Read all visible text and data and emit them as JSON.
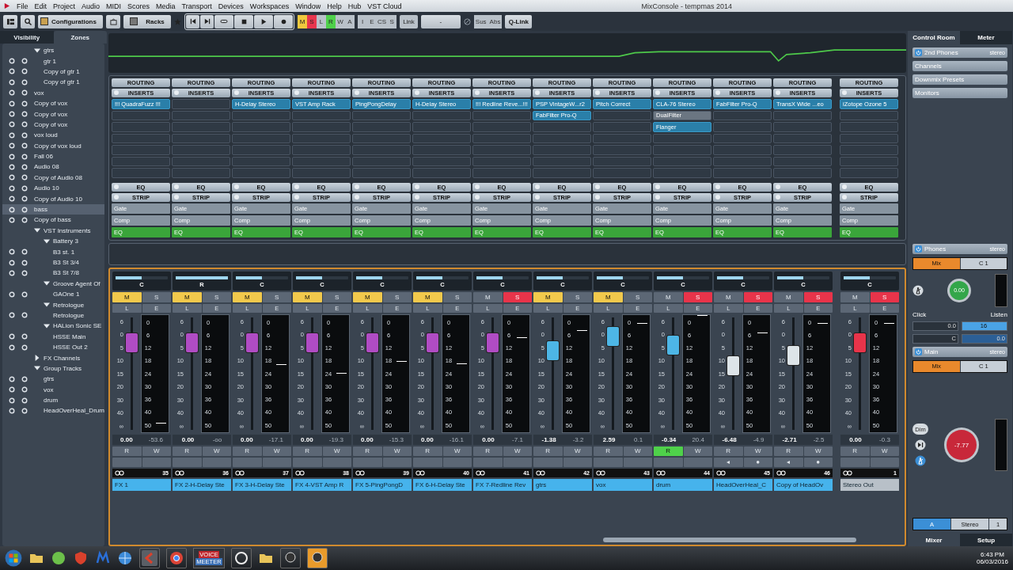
{
  "menu": [
    "File",
    "Edit",
    "Project",
    "Audio",
    "MIDI",
    "Scores",
    "Media",
    "Transport",
    "Devices",
    "Workspaces",
    "Window",
    "Help",
    "Hub",
    "VST Cloud"
  ],
  "window": {
    "title": "MixConsole - tempmas 2014"
  },
  "toolbar": {
    "configurations": "Configurations",
    "racks": "Racks",
    "modes": [
      {
        "label": "M",
        "on": true,
        "color": "#f0c93e"
      },
      {
        "label": "S",
        "on": true,
        "color": "#e8364e"
      },
      {
        "label": "L",
        "on": false
      },
      {
        "label": "R",
        "on": true,
        "color": "#4fd14a"
      },
      {
        "label": "W",
        "on": false
      },
      {
        "label": "A",
        "on": false
      }
    ],
    "modes2": [
      "I",
      "E",
      "CS",
      "S"
    ],
    "link_label": "Link",
    "link_value": "-",
    "sus": "Sus",
    "abs": "Abs",
    "qlink": "Q-Link"
  },
  "left_tabs": [
    {
      "label": "Visibility",
      "selected": false
    },
    {
      "label": "Zones",
      "selected": true
    }
  ],
  "tree": [
    {
      "label": "gtrs",
      "expanded": true,
      "selected": false,
      "children": [
        {
          "label": "gtr 1",
          "selected": false
        },
        {
          "label": "Copy of gtr 1",
          "selected": false
        },
        {
          "label": "Copy of gtr 1",
          "selected": false
        }
      ]
    },
    {
      "label": "vox",
      "selected": false
    },
    {
      "label": "Copy of vox",
      "selected": false
    },
    {
      "label": "Copy of vox",
      "selected": false
    },
    {
      "label": "Copy of vox",
      "selected": false
    },
    {
      "label": "vox loud",
      "selected": false
    },
    {
      "label": "Copy of vox loud",
      "selected": false
    },
    {
      "label": "Fall 06",
      "selected": false
    },
    {
      "label": "Audio 08",
      "selected": false
    },
    {
      "label": "Copy of Audio 08",
      "selected": false
    },
    {
      "label": "Audio 10",
      "selected": false
    },
    {
      "label": "Copy of Audio 10",
      "selected": false
    },
    {
      "label": "bass",
      "selected": true
    },
    {
      "label": "Copy of bass",
      "selected": false
    },
    {
      "label": "VST Instruments",
      "expanded": true,
      "selected": false,
      "children": [
        {
          "label": "Battery 3",
          "expanded": true,
          "selected": false,
          "children": [
            {
              "label": "B3 st. 1",
              "selected": false
            },
            {
              "label": "B3 St 3/4",
              "selected": false
            },
            {
              "label": "B3 St 7/8",
              "selected": false
            }
          ]
        },
        {
          "label": "Groove Agent Of",
          "expanded": true,
          "selected": false,
          "children": [
            {
              "label": "GAOne 1",
              "selected": false
            }
          ]
        },
        {
          "label": "Retrologue",
          "expanded": true,
          "selected": false,
          "children": [
            {
              "label": "Retrologue",
              "selected": false
            }
          ]
        },
        {
          "label": "HALion Sonic SE",
          "expanded": true,
          "selected": false,
          "children": [
            {
              "label": "HSSE Main",
              "selected": false
            },
            {
              "label": "HSSE Out 2",
              "selected": false
            }
          ]
        }
      ]
    },
    {
      "label": "FX Channels",
      "expanded": false,
      "selected": false
    },
    {
      "label": "Group Tracks",
      "expanded": true,
      "selected": false,
      "children": [
        {
          "label": "gtrs",
          "selected": false
        },
        {
          "label": "vox",
          "selected": false
        },
        {
          "label": "drum",
          "selected": false
        },
        {
          "label": "HeadOverHeal_Drum",
          "selected": false
        }
      ]
    }
  ],
  "channels": [
    {
      "name": "FX 1",
      "number": "35",
      "kind": "channel",
      "color": "#b04cc4",
      "pan": {
        "label": "C",
        "level": 0.5
      },
      "mute": {
        "label": "M",
        "on": true
      },
      "solo": {
        "label": "S",
        "on": false
      },
      "listen": "L",
      "edit": "E",
      "fader": {
        "level": 0.77
      },
      "meter": {
        "level": 0.07
      },
      "volume": "0.00",
      "peak": "-53.6",
      "read": {
        "label": "R",
        "on": false
      },
      "write": {
        "label": "W",
        "on": false
      },
      "routing": "ROUTING",
      "inserts_label": "INSERTS",
      "inserts": [
        {
          "name": "!!! QuadraFuzz !!!",
          "active": true
        }
      ],
      "eq": "EQ",
      "strip": "STRIP",
      "modules": [
        {
          "label": "Gate",
          "on": false
        },
        {
          "label": "Comp",
          "on": false
        },
        {
          "label": "EQ",
          "on": true
        }
      ],
      "fader_scale": [
        "6",
        "0",
        "5",
        "10",
        "15",
        "20",
        "30",
        "40",
        "∞"
      ],
      "meter_scale": [
        "0",
        "6",
        "12",
        "18",
        "24",
        "30",
        "36",
        "40",
        "50"
      ]
    },
    {
      "name": "FX 2-H-Delay Ste",
      "number": "36",
      "kind": "channel",
      "color": "#b04cc4",
      "pan": {
        "label": "R",
        "level": 1
      },
      "mute": {
        "label": "M",
        "on": true
      },
      "solo": {
        "label": "S",
        "on": false
      },
      "listen": "L",
      "edit": "E",
      "fader": {
        "level": 0.77
      },
      "volume": "0.00",
      "peak": "-oo",
      "read": {
        "label": "R",
        "on": false
      },
      "write": {
        "label": "W",
        "on": false
      },
      "routing": "ROUTING",
      "inserts_label": "INSERTS",
      "eq": "EQ",
      "strip": "STRIP",
      "modules": [
        {
          "label": "Gate",
          "on": false
        },
        {
          "label": "Comp",
          "on": false
        },
        {
          "label": "EQ",
          "on": true
        }
      ],
      "fader_scale": [
        "6",
        "0",
        "5",
        "10",
        "15",
        "20",
        "30",
        "40",
        "∞"
      ],
      "meter_scale": [
        "0",
        "6",
        "12",
        "18",
        "24",
        "30",
        "36",
        "40",
        "50"
      ]
    },
    {
      "name": "FX 3-H-Delay Ste",
      "number": "37",
      "kind": "channel",
      "color": "#b04cc4",
      "pan": {
        "label": "C",
        "level": 0.5
      },
      "mute": {
        "label": "M",
        "on": true
      },
      "solo": {
        "label": "S",
        "on": false
      },
      "listen": "L",
      "edit": "E",
      "fader": {
        "level": 0.77
      },
      "meter": {
        "level": 0.57
      },
      "volume": "0.00",
      "peak": "-17.1",
      "read": {
        "label": "R",
        "on": false
      },
      "write": {
        "label": "W",
        "on": false
      },
      "routing": "ROUTING",
      "inserts_label": "INSERTS",
      "inserts": [
        {
          "name": "H-Delay Stereo",
          "active": true
        }
      ],
      "eq": "EQ",
      "strip": "STRIP",
      "modules": [
        {
          "label": "Gate",
          "on": false
        },
        {
          "label": "Comp",
          "on": false
        },
        {
          "label": "EQ",
          "on": true
        }
      ],
      "fader_scale": [
        "6",
        "0",
        "5",
        "10",
        "15",
        "20",
        "30",
        "40",
        "∞"
      ],
      "meter_scale": [
        "0",
        "6",
        "12",
        "18",
        "24",
        "30",
        "36",
        "40",
        "50"
      ]
    },
    {
      "name": "FX 4-VST Amp R",
      "number": "38",
      "kind": "channel",
      "color": "#b04cc4",
      "pan": {
        "label": "C",
        "level": 0.5
      },
      "mute": {
        "label": "M",
        "on": true
      },
      "solo": {
        "label": "S",
        "on": false
      },
      "listen": "L",
      "edit": "E",
      "fader": {
        "level": 0.77
      },
      "meter": {
        "level": 0.5
      },
      "volume": "0.00",
      "peak": "-19.3",
      "read": {
        "label": "R",
        "on": false
      },
      "write": {
        "label": "W",
        "on": false
      },
      "routing": "ROUTING",
      "inserts_label": "INSERTS",
      "inserts": [
        {
          "name": "VST Amp Rack",
          "active": true
        }
      ],
      "eq": "EQ",
      "strip": "STRIP",
      "modules": [
        {
          "label": "Gate",
          "on": false
        },
        {
          "label": "Comp",
          "on": false
        },
        {
          "label": "EQ",
          "on": true
        }
      ],
      "fader_scale": [
        "6",
        "0",
        "5",
        "10",
        "15",
        "20",
        "30",
        "40",
        "∞"
      ],
      "meter_scale": [
        "0",
        "6",
        "12",
        "18",
        "24",
        "30",
        "36",
        "40",
        "50"
      ]
    },
    {
      "name": "FX 5-PingPongD",
      "number": "39",
      "kind": "channel",
      "color": "#b04cc4",
      "pan": {
        "label": "C",
        "level": 0.5
      },
      "mute": {
        "label": "M",
        "on": true
      },
      "solo": {
        "label": "S",
        "on": false
      },
      "listen": "L",
      "edit": "E",
      "fader": {
        "level": 0.77
      },
      "meter": {
        "level": 0.6
      },
      "volume": "0.00",
      "peak": "-15.3",
      "read": {
        "label": "R",
        "on": false
      },
      "write": {
        "label": "W",
        "on": false
      },
      "routing": "ROUTING",
      "inserts_label": "INSERTS",
      "inserts": [
        {
          "name": "PingPongDelay",
          "active": true
        }
      ],
      "eq": "EQ",
      "strip": "STRIP",
      "modules": [
        {
          "label": "Gate",
          "on": false
        },
        {
          "label": "Comp",
          "on": false
        },
        {
          "label": "EQ",
          "on": true
        }
      ],
      "fader_scale": [
        "6",
        "0",
        "5",
        "10",
        "15",
        "20",
        "30",
        "40",
        "∞"
      ],
      "meter_scale": [
        "0",
        "6",
        "12",
        "18",
        "24",
        "30",
        "36",
        "40",
        "50"
      ]
    },
    {
      "name": "FX 6-H-Delay Ste",
      "number": "40",
      "kind": "channel",
      "color": "#b04cc4",
      "pan": {
        "label": "C",
        "level": 0.5
      },
      "mute": {
        "label": "M",
        "on": true
      },
      "solo": {
        "label": "S",
        "on": false
      },
      "listen": "L",
      "edit": "E",
      "fader": {
        "level": 0.77
      },
      "meter": {
        "level": 0.58
      },
      "volume": "0.00",
      "peak": "-16.1",
      "read": {
        "label": "R",
        "on": false
      },
      "write": {
        "label": "W",
        "on": false
      },
      "routing": "ROUTING",
      "inserts_label": "INSERTS",
      "inserts": [
        {
          "name": "H-Delay Stereo",
          "active": true
        }
      ],
      "eq": "EQ",
      "strip": "STRIP",
      "modules": [
        {
          "label": "Gate",
          "on": false
        },
        {
          "label": "Comp",
          "on": false
        },
        {
          "label": "EQ",
          "on": true
        }
      ],
      "fader_scale": [
        "6",
        "0",
        "5",
        "10",
        "15",
        "20",
        "30",
        "40",
        "∞"
      ],
      "meter_scale": [
        "0",
        "6",
        "12",
        "18",
        "24",
        "30",
        "36",
        "40",
        "50"
      ]
    },
    {
      "name": "FX 7-Redline Rev",
      "number": "41",
      "kind": "channel",
      "color": "#b04cc4",
      "pan": {
        "label": "C",
        "level": 0.5
      },
      "mute": {
        "label": "M",
        "on": false
      },
      "solo": {
        "label": "S",
        "on": true
      },
      "listen": "L",
      "edit": "E",
      "fader": {
        "level": 0.77
      },
      "meter": {
        "level": 0.8
      },
      "volume": "0.00",
      "peak": "-7.1",
      "read": {
        "label": "R",
        "on": false
      },
      "write": {
        "label": "W",
        "on": false
      },
      "routing": "ROUTING",
      "inserts_label": "INSERTS",
      "inserts": [
        {
          "name": "!!! Redline Reve...!!!",
          "active": true
        }
      ],
      "eq": "EQ",
      "strip": "STRIP",
      "modules": [
        {
          "label": "Gate",
          "on": false
        },
        {
          "label": "Comp",
          "on": false
        },
        {
          "label": "EQ",
          "on": true
        }
      ],
      "fader_scale": [
        "6",
        "0",
        "5",
        "10",
        "15",
        "20",
        "30",
        "40",
        "∞"
      ],
      "meter_scale": [
        "0",
        "6",
        "12",
        "18",
        "24",
        "30",
        "36",
        "40",
        "50"
      ]
    },
    {
      "name": "gtrs",
      "number": "42",
      "kind": "channel",
      "color": "#4db6e6",
      "pan": {
        "label": "C",
        "level": 0.5
      },
      "mute": {
        "label": "M",
        "on": true
      },
      "solo": {
        "label": "S",
        "on": false
      },
      "listen": "L",
      "edit": "E",
      "fader": {
        "level": 0.7
      },
      "meter": {
        "level": 0.86
      },
      "volume": "-1.38",
      "peak": "-3.2",
      "read": {
        "label": "R",
        "on": false
      },
      "write": {
        "label": "W",
        "on": false
      },
      "routing": "ROUTING",
      "inserts_label": "INSERTS",
      "inserts": [
        {
          "name": "PSP VintageW...r2",
          "active": true
        },
        {
          "name": "FabFilter Pro-Q",
          "active": true
        }
      ],
      "eq": "EQ",
      "strip": "STRIP",
      "modules": [
        {
          "label": "Gate",
          "on": false
        },
        {
          "label": "Comp",
          "on": false
        },
        {
          "label": "EQ",
          "on": true
        }
      ],
      "fader_scale": [
        "6",
        "0",
        "5",
        "10",
        "15",
        "20",
        "30",
        "40",
        "∞"
      ],
      "meter_scale": [
        "0",
        "6",
        "12",
        "18",
        "24",
        "30",
        "36",
        "40",
        "50"
      ]
    },
    {
      "name": "vox",
      "number": "43",
      "kind": "channel",
      "color": "#4db6e6",
      "pan": {
        "label": "C",
        "level": 0.5
      },
      "mute": {
        "label": "M",
        "on": true
      },
      "solo": {
        "label": "S",
        "on": false
      },
      "listen": "L",
      "edit": "E",
      "fader": {
        "level": 0.83
      },
      "meter": {
        "level": 0.92
      },
      "volume": "2.59",
      "peak": "0.1",
      "read": {
        "label": "R",
        "on": false
      },
      "write": {
        "label": "W",
        "on": false
      },
      "routing": "ROUTING",
      "inserts_label": "INSERTS",
      "inserts": [
        {
          "name": "Pitch Correct",
          "active": true
        }
      ],
      "eq": "EQ",
      "strip": "STRIP",
      "modules": [
        {
          "label": "Gate",
          "on": false
        },
        {
          "label": "Comp",
          "on": false
        },
        {
          "label": "EQ",
          "on": true
        }
      ],
      "fader_scale": [
        "6",
        "0",
        "5",
        "10",
        "15",
        "20",
        "30",
        "40",
        "∞"
      ],
      "meter_scale": [
        "0",
        "6",
        "12",
        "18",
        "24",
        "30",
        "36",
        "40",
        "50"
      ]
    },
    {
      "name": "drum",
      "number": "44",
      "kind": "channel",
      "color": "#4db6e6",
      "pan": {
        "label": "C",
        "level": 0.5
      },
      "mute": {
        "label": "M",
        "on": false
      },
      "solo": {
        "label": "S",
        "on": true
      },
      "listen": "L",
      "edit": "E",
      "fader": {
        "level": 0.75
      },
      "meter": {
        "level": 0.99
      },
      "volume": "-0.34",
      "peak": "20.4",
      "read": {
        "label": "R",
        "on": true
      },
      "write": {
        "label": "W",
        "on": false
      },
      "routing": "ROUTING",
      "inserts_label": "INSERTS",
      "inserts": [
        {
          "name": "CLA-76 Stereo",
          "active": true
        },
        {
          "name": "DualFilter",
          "active": false
        },
        {
          "name": "Flanger",
          "active": true
        }
      ],
      "eq": "EQ",
      "strip": "STRIP",
      "modules": [
        {
          "label": "Gate",
          "on": false
        },
        {
          "label": "Comp",
          "on": false
        },
        {
          "label": "EQ",
          "on": true
        }
      ],
      "fader_scale": [
        "6",
        "0",
        "5",
        "10",
        "15",
        "20",
        "30",
        "40",
        "∞"
      ],
      "meter_scale": [
        "0",
        "6",
        "12",
        "18",
        "24",
        "30",
        "36",
        "40",
        "50"
      ]
    },
    {
      "name": "HeadOverHeal_C",
      "number": "45",
      "kind": "channel",
      "color": "#dde4e8",
      "pan": {
        "label": "C",
        "level": 0.5
      },
      "mute": {
        "label": "M",
        "on": false
      },
      "solo": {
        "label": "S",
        "on": true
      },
      "listen": "L",
      "edit": "E",
      "fader": {
        "level": 0.57
      },
      "meter": {
        "level": 0.84
      },
      "volume": "-6.48",
      "peak": "-4.9",
      "read": {
        "label": "R",
        "on": false
      },
      "write": {
        "label": "W",
        "on": false
      },
      "extra": [
        "◂",
        "●"
      ],
      "routing": "ROUTING",
      "inserts_label": "INSERTS",
      "inserts": [
        {
          "name": "FabFilter Pro-Q",
          "active": true
        }
      ],
      "eq": "EQ",
      "strip": "STRIP",
      "modules": [
        {
          "label": "Gate",
          "on": false
        },
        {
          "label": "Comp",
          "on": false
        },
        {
          "label": "EQ",
          "on": true
        }
      ],
      "fader_scale": [
        "6",
        "0",
        "5",
        "10",
        "15",
        "20",
        "30",
        "40",
        "∞"
      ],
      "meter_scale": [
        "0",
        "6",
        "12",
        "18",
        "24",
        "30",
        "36",
        "40",
        "50"
      ]
    },
    {
      "name": "Copy of HeadOv",
      "number": "46",
      "kind": "channel",
      "color": "#dde4e8",
      "pan": {
        "label": "C",
        "level": 0.5
      },
      "mute": {
        "label": "M",
        "on": false
      },
      "solo": {
        "label": "S",
        "on": true
      },
      "listen": "L",
      "edit": "E",
      "fader": {
        "level": 0.66
      },
      "meter": {
        "level": 0.92
      },
      "volume": "-2.71",
      "peak": "-2.5",
      "read": {
        "label": "R",
        "on": false
      },
      "write": {
        "label": "W",
        "on": false
      },
      "extra": [
        "◂",
        "●"
      ],
      "routing": "ROUTING",
      "inserts_label": "INSERTS",
      "inserts": [
        {
          "name": "TransX Wide ...eo",
          "active": true
        }
      ],
      "eq": "EQ",
      "strip": "STRIP",
      "modules": [
        {
          "label": "Gate",
          "on": false
        },
        {
          "label": "Comp",
          "on": false
        },
        {
          "label": "EQ",
          "on": true
        }
      ],
      "fader_scale": [
        "6",
        "0",
        "5",
        "10",
        "15",
        "20",
        "30",
        "40",
        "∞"
      ],
      "meter_scale": [
        "0",
        "6",
        "12",
        "18",
        "24",
        "30",
        "36",
        "40",
        "50"
      ]
    },
    {
      "name": "Stereo Out",
      "number": "1",
      "kind": "output",
      "color": "#e8344a",
      "pan": {
        "label": "C",
        "level": 0.5
      },
      "mute": {
        "label": "M",
        "on": false
      },
      "solo": {
        "label": "S",
        "on": true
      },
      "listen": "L",
      "edit": "E",
      "fader": {
        "level": 0.77
      },
      "meter": {
        "level": 0.92
      },
      "volume": "0.00",
      "peak": "-0.3",
      "read": {
        "label": "R",
        "on": false
      },
      "write": {
        "label": "W",
        "on": false
      },
      "routing": "ROUTING",
      "inserts_label": "INSERTS",
      "inserts": [
        {
          "name": "iZotope Ozone 5",
          "active": true
        }
      ],
      "eq": "EQ",
      "strip": "STRIP",
      "modules": [
        {
          "label": "Gate",
          "on": false
        },
        {
          "label": "Comp",
          "on": false
        },
        {
          "label": "EQ",
          "on": true
        }
      ],
      "fader_scale": [
        "6",
        "0",
        "5",
        "10",
        "15",
        "20",
        "30",
        "40",
        "∞"
      ],
      "meter_scale": [
        "0",
        "6",
        "12",
        "18",
        "24",
        "30",
        "36",
        "40",
        "50"
      ]
    }
  ],
  "control_room": {
    "tabs": [
      {
        "label": "Control Room",
        "selected": true
      },
      {
        "label": "Meter",
        "selected": false
      }
    ],
    "sections": [
      {
        "label": "2nd Phones",
        "value": "stereo",
        "power": true
      },
      {
        "label": "Channels"
      },
      {
        "label": "Downmix Presets"
      },
      {
        "label": "Monitors"
      }
    ],
    "phones": {
      "label": "Phones",
      "value": "stereo",
      "power": true,
      "source": [
        {
          "label": "Mix",
          "selected": true
        },
        {
          "label": "C 1",
          "selected": false
        }
      ],
      "knob": "0.00",
      "click_label": "Click",
      "listen_label": "Listen",
      "click_level": "0.0",
      "click_pan": "C",
      "listen_value": "16",
      "listen_level": "0.0"
    },
    "main": {
      "label": "Main",
      "value": "stereo",
      "power": true,
      "source": [
        {
          "label": "Mix",
          "selected": true
        },
        {
          "label": "C 1",
          "selected": false
        }
      ],
      "dim": "Dim",
      "knob": "-7.77",
      "outputs": [
        {
          "label": "A",
          "selected": true
        },
        {
          "label": "Stereo",
          "selected": false
        },
        {
          "label": "1",
          "selected": false
        }
      ]
    },
    "bottom_tabs": [
      {
        "label": "Mixer",
        "selected": true
      },
      {
        "label": "Setup",
        "selected": false
      }
    ]
  },
  "taskbar": {
    "voicemeeter": [
      "VOICE",
      "MEETER"
    ],
    "time": "6:43 PM",
    "date": "06/03/2016"
  }
}
